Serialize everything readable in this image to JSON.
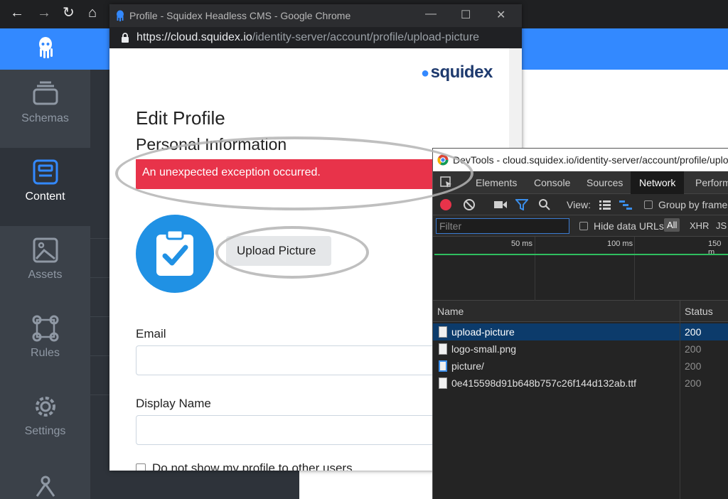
{
  "popup": {
    "title": "Profile - Squidex Headless CMS - Google Chrome",
    "url_host": "https://cloud.squidex.io",
    "url_path": "/identity-server/account/profile/upload-picture",
    "brand": "squidex",
    "heading": "Edit Profile",
    "subheading": "Personal Information",
    "error": "An unexpected exception occurred.",
    "upload_label": "Upload Picture",
    "email_label": "Email",
    "display_name_label": "Display Name",
    "hide_profile_label": "Do not show my profile to other users"
  },
  "sidebar": {
    "items": [
      {
        "label": "Schemas",
        "icon": "schemas-icon"
      },
      {
        "label": "Content",
        "icon": "content-icon",
        "active": true
      },
      {
        "label": "Assets",
        "icon": "assets-icon"
      },
      {
        "label": "Rules",
        "icon": "rules-icon"
      },
      {
        "label": "Settings",
        "icon": "gear-icon"
      }
    ]
  },
  "devtools": {
    "title": "DevTools - cloud.squidex.io/identity-server/account/profile/uplo",
    "tabs": [
      "Elements",
      "Console",
      "Sources",
      "Network",
      "Perform"
    ],
    "active_tab": "Network",
    "view_label": "View:",
    "group_by_frame": "Group by frame",
    "filter_placeholder": "Filter",
    "hide_data_urls": "Hide data URLs",
    "filter_types": [
      "All",
      "XHR",
      "JS"
    ],
    "timeline_ticks": [
      "50 ms",
      "100 ms",
      "150 m"
    ],
    "columns": {
      "name": "Name",
      "status": "Status"
    },
    "requests": [
      {
        "name": "upload-picture",
        "status": "200",
        "selected": true
      },
      {
        "name": "logo-small.png",
        "status": "200"
      },
      {
        "name": "picture/",
        "status": "200"
      },
      {
        "name": "0e415598d91b648b757c26f144d132ab.ttf",
        "status": "200"
      }
    ]
  },
  "colors": {
    "accent": "#3389ff",
    "error": "#e8334a",
    "sidebar": "#3b4149"
  }
}
